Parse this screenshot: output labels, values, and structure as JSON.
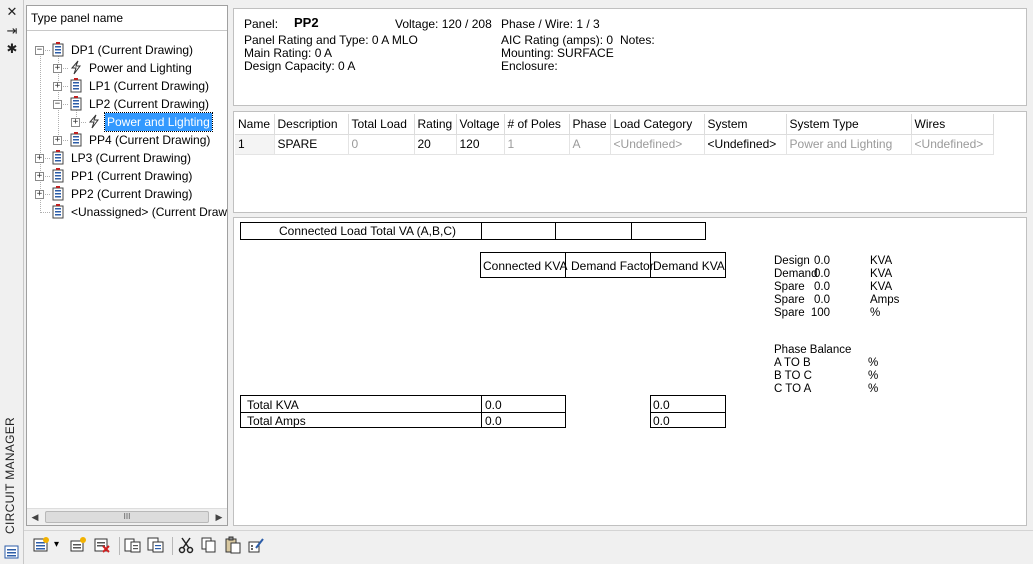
{
  "palette": {
    "title": "CIRCUIT MANAGER",
    "close_icon": "close-icon",
    "autohide_icon": "autohide-icon",
    "properties_icon": "gear-icon"
  },
  "tree": {
    "search_placeholder": "Type panel name",
    "nodes": [
      {
        "label": "DP1 (Current Drawing)",
        "icon": "panel-icon",
        "expander": "−"
      },
      {
        "label": "Power and Lighting",
        "icon": "lightning-icon",
        "expander": "+"
      },
      {
        "label": "LP1 (Current Drawing)",
        "icon": "panel-icon",
        "expander": "+"
      },
      {
        "label": "LP2 (Current Drawing)",
        "icon": "panel-icon",
        "expander": "−"
      },
      {
        "label": "Power and Lighting",
        "icon": "lightning-icon",
        "expander": "+",
        "selected": true
      },
      {
        "label": "PP4 (Current Drawing)",
        "icon": "panel-icon",
        "expander": "+"
      },
      {
        "label": "LP3 (Current Drawing)",
        "icon": "panel-icon",
        "expander": "+"
      },
      {
        "label": "PP1 (Current Drawing)",
        "icon": "panel-icon",
        "expander": "+"
      },
      {
        "label": "PP2 (Current Drawing)",
        "icon": "panel-icon",
        "expander": "+"
      },
      {
        "label": "<Unassigned> (Current Drawi",
        "icon": "panel-icon",
        "expander": ""
      }
    ],
    "scroll_thumb": "III"
  },
  "info": {
    "panel_label": "Panel:",
    "panel_name": "PP2",
    "voltage_label": "Voltage: 120 / 208",
    "phase_wire_label": "Phase / Wire:  1 /  3",
    "rating_type": "Panel Rating and Type: 0 A MLO",
    "aic_rating": "AIC Rating (amps):  0",
    "notes_label": "Notes:",
    "main_rating": "Main Rating: 0 A",
    "mounting": "Mounting: SURFACE",
    "design_capacity": "Design Capacity: 0 A",
    "enclosure": "Enclosure:"
  },
  "grid": {
    "columns": [
      "Name",
      "Description",
      "Total Load",
      "Rating",
      "Voltage",
      "# of Poles",
      "Phase",
      "Load Category",
      "System",
      "System Type",
      "Wires"
    ],
    "rows": [
      [
        "1",
        "SPARE",
        "0",
        "20",
        "120",
        "1",
        "A",
        "<Undefined>",
        "<Undefined>",
        "Power and Lighting",
        "<Undefined>"
      ]
    ]
  },
  "summary": {
    "connected_load_total": "Connected Load Total VA (A,B,C)",
    "connected_kva": "Connected KVA",
    "demand_factor": "Demand Factor",
    "demand_kva": "Demand KVA",
    "total_kva_label": "Total KVA",
    "total_amps_label": "Total Amps",
    "total_kva_connected": "0.0",
    "total_kva_demand": "0.0",
    "total_amps_connected": "0.0",
    "total_amps_demand": "0.0",
    "stats": [
      {
        "label": "Design",
        "value": "0.0",
        "unit": "KVA"
      },
      {
        "label": "Demand",
        "value": "0.0",
        "unit": "KVA"
      },
      {
        "label": "Spare",
        "value": "0.0",
        "unit": "KVA"
      },
      {
        "label": "Spare",
        "value": "0.0",
        "unit": "Amps"
      },
      {
        "label": "Spare",
        "value": "100",
        "unit": "%"
      }
    ],
    "phase_balance_title": "Phase Balance",
    "phase_balance": [
      {
        "label": "A TO B",
        "unit": "%"
      },
      {
        "label": "B TO C",
        "unit": "%"
      },
      {
        "label": "C TO A",
        "unit": "%"
      }
    ]
  },
  "toolbar": {
    "dropdown_arrow": "▾",
    "buttons": [
      "new-panel-icon",
      "new-circuit-icon",
      "delete-icon",
      "generate-schedule-icon",
      "update-schedule-icon",
      "cut-icon",
      "copy-icon",
      "paste-icon",
      "calculator-icon"
    ]
  }
}
